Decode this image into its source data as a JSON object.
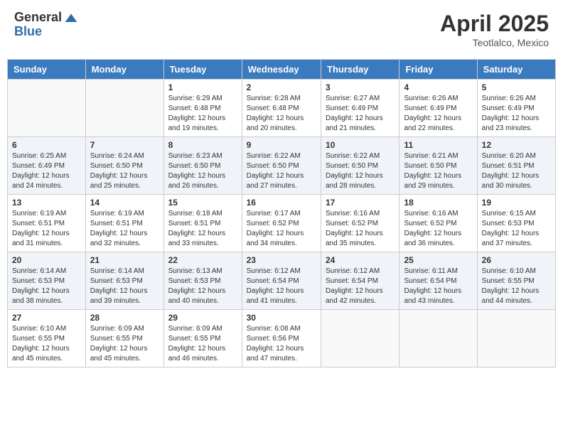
{
  "header": {
    "logo_general": "General",
    "logo_blue": "Blue",
    "month": "April 2025",
    "location": "Teotlalco, Mexico"
  },
  "weekdays": [
    "Sunday",
    "Monday",
    "Tuesday",
    "Wednesday",
    "Thursday",
    "Friday",
    "Saturday"
  ],
  "weeks": [
    [
      {
        "day": "",
        "info": ""
      },
      {
        "day": "",
        "info": ""
      },
      {
        "day": "1",
        "info": "Sunrise: 6:29 AM\nSunset: 6:48 PM\nDaylight: 12 hours and 19 minutes."
      },
      {
        "day": "2",
        "info": "Sunrise: 6:28 AM\nSunset: 6:48 PM\nDaylight: 12 hours and 20 minutes."
      },
      {
        "day": "3",
        "info": "Sunrise: 6:27 AM\nSunset: 6:49 PM\nDaylight: 12 hours and 21 minutes."
      },
      {
        "day": "4",
        "info": "Sunrise: 6:26 AM\nSunset: 6:49 PM\nDaylight: 12 hours and 22 minutes."
      },
      {
        "day": "5",
        "info": "Sunrise: 6:26 AM\nSunset: 6:49 PM\nDaylight: 12 hours and 23 minutes."
      }
    ],
    [
      {
        "day": "6",
        "info": "Sunrise: 6:25 AM\nSunset: 6:49 PM\nDaylight: 12 hours and 24 minutes."
      },
      {
        "day": "7",
        "info": "Sunrise: 6:24 AM\nSunset: 6:50 PM\nDaylight: 12 hours and 25 minutes."
      },
      {
        "day": "8",
        "info": "Sunrise: 6:23 AM\nSunset: 6:50 PM\nDaylight: 12 hours and 26 minutes."
      },
      {
        "day": "9",
        "info": "Sunrise: 6:22 AM\nSunset: 6:50 PM\nDaylight: 12 hours and 27 minutes."
      },
      {
        "day": "10",
        "info": "Sunrise: 6:22 AM\nSunset: 6:50 PM\nDaylight: 12 hours and 28 minutes."
      },
      {
        "day": "11",
        "info": "Sunrise: 6:21 AM\nSunset: 6:50 PM\nDaylight: 12 hours and 29 minutes."
      },
      {
        "day": "12",
        "info": "Sunrise: 6:20 AM\nSunset: 6:51 PM\nDaylight: 12 hours and 30 minutes."
      }
    ],
    [
      {
        "day": "13",
        "info": "Sunrise: 6:19 AM\nSunset: 6:51 PM\nDaylight: 12 hours and 31 minutes."
      },
      {
        "day": "14",
        "info": "Sunrise: 6:19 AM\nSunset: 6:51 PM\nDaylight: 12 hours and 32 minutes."
      },
      {
        "day": "15",
        "info": "Sunrise: 6:18 AM\nSunset: 6:51 PM\nDaylight: 12 hours and 33 minutes."
      },
      {
        "day": "16",
        "info": "Sunrise: 6:17 AM\nSunset: 6:52 PM\nDaylight: 12 hours and 34 minutes."
      },
      {
        "day": "17",
        "info": "Sunrise: 6:16 AM\nSunset: 6:52 PM\nDaylight: 12 hours and 35 minutes."
      },
      {
        "day": "18",
        "info": "Sunrise: 6:16 AM\nSunset: 6:52 PM\nDaylight: 12 hours and 36 minutes."
      },
      {
        "day": "19",
        "info": "Sunrise: 6:15 AM\nSunset: 6:53 PM\nDaylight: 12 hours and 37 minutes."
      }
    ],
    [
      {
        "day": "20",
        "info": "Sunrise: 6:14 AM\nSunset: 6:53 PM\nDaylight: 12 hours and 38 minutes."
      },
      {
        "day": "21",
        "info": "Sunrise: 6:14 AM\nSunset: 6:53 PM\nDaylight: 12 hours and 39 minutes."
      },
      {
        "day": "22",
        "info": "Sunrise: 6:13 AM\nSunset: 6:53 PM\nDaylight: 12 hours and 40 minutes."
      },
      {
        "day": "23",
        "info": "Sunrise: 6:12 AM\nSunset: 6:54 PM\nDaylight: 12 hours and 41 minutes."
      },
      {
        "day": "24",
        "info": "Sunrise: 6:12 AM\nSunset: 6:54 PM\nDaylight: 12 hours and 42 minutes."
      },
      {
        "day": "25",
        "info": "Sunrise: 6:11 AM\nSunset: 6:54 PM\nDaylight: 12 hours and 43 minutes."
      },
      {
        "day": "26",
        "info": "Sunrise: 6:10 AM\nSunset: 6:55 PM\nDaylight: 12 hours and 44 minutes."
      }
    ],
    [
      {
        "day": "27",
        "info": "Sunrise: 6:10 AM\nSunset: 6:55 PM\nDaylight: 12 hours and 45 minutes."
      },
      {
        "day": "28",
        "info": "Sunrise: 6:09 AM\nSunset: 6:55 PM\nDaylight: 12 hours and 45 minutes."
      },
      {
        "day": "29",
        "info": "Sunrise: 6:09 AM\nSunset: 6:55 PM\nDaylight: 12 hours and 46 minutes."
      },
      {
        "day": "30",
        "info": "Sunrise: 6:08 AM\nSunset: 6:56 PM\nDaylight: 12 hours and 47 minutes."
      },
      {
        "day": "",
        "info": ""
      },
      {
        "day": "",
        "info": ""
      },
      {
        "day": "",
        "info": ""
      }
    ]
  ]
}
